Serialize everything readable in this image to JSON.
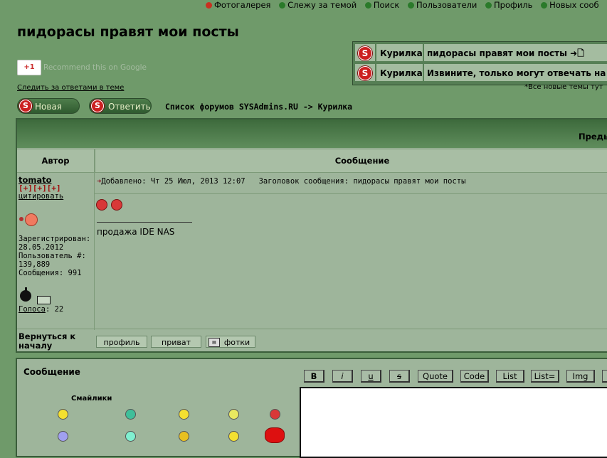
{
  "nav": {
    "items": [
      {
        "label": "Фотогалерея",
        "color": "#c83020"
      },
      {
        "label": "Слежу за темой",
        "color": "#2a7a2a"
      },
      {
        "label": "Поиск",
        "color": "#2a7a2a"
      },
      {
        "label": "Пользователи",
        "color": "#2a7a2a"
      },
      {
        "label": "Профиль",
        "color": "#2a7a2a"
      },
      {
        "label": "Новых сооб",
        "color": "#2a7a2a"
      }
    ]
  },
  "page_title": "пидорасы правят мои посты",
  "recent_topics": [
    {
      "forum": "Курилка",
      "title": "пидорасы правят мои посты ➜🗋"
    },
    {
      "forum": "Курилка",
      "title": "Извините, только могут отвечать на се"
    }
  ],
  "new_topics_note": "*Все новые темы тут",
  "gplus": {
    "badge": "+1",
    "text": "Recommend this on Google"
  },
  "follow_link": "Следить за ответами в теме",
  "buttons": {
    "new_topic": "Новая тема",
    "reply": "Ответить"
  },
  "breadcrumb": "Список форумов SYSAdmins.RU -> Курилка",
  "table": {
    "prev_link": "Преды",
    "col_author": "Автор",
    "col_message": "Сообщение"
  },
  "post": {
    "author": "tomato",
    "rank": "[+][+][+]",
    "quote_link": "цитировать",
    "registered_label": "Зарегистрирован:",
    "registered_value": "28.05.2012",
    "user_no_label": "Пользователь #:",
    "user_no_value": "139,889",
    "messages_label": "Сообщения:",
    "messages_value": "991",
    "votes_label": "Голоса",
    "votes_value": ": 22",
    "meta_added": "Добавлено: Чт 25 Июл, 2013 12:07",
    "meta_subject": "Заголовок сообщения: пидорасы правят мои посты",
    "signature": "продажа IDE NAS"
  },
  "back_to_top": "Вернуться к началу",
  "post_buttons": {
    "profile": "профиль",
    "pm": "приват",
    "photos": "фотки"
  },
  "reply_area": {
    "label": "Сообщение",
    "smilies_label": "Смайлики",
    "format_buttons": [
      "B",
      "i",
      "u",
      "s",
      "Quote",
      "Code",
      "List",
      "List=",
      "Img"
    ]
  },
  "colors": {
    "bg": "#6f9a6a",
    "panel": "#9eb59b",
    "accent_red": "#cc2020"
  }
}
